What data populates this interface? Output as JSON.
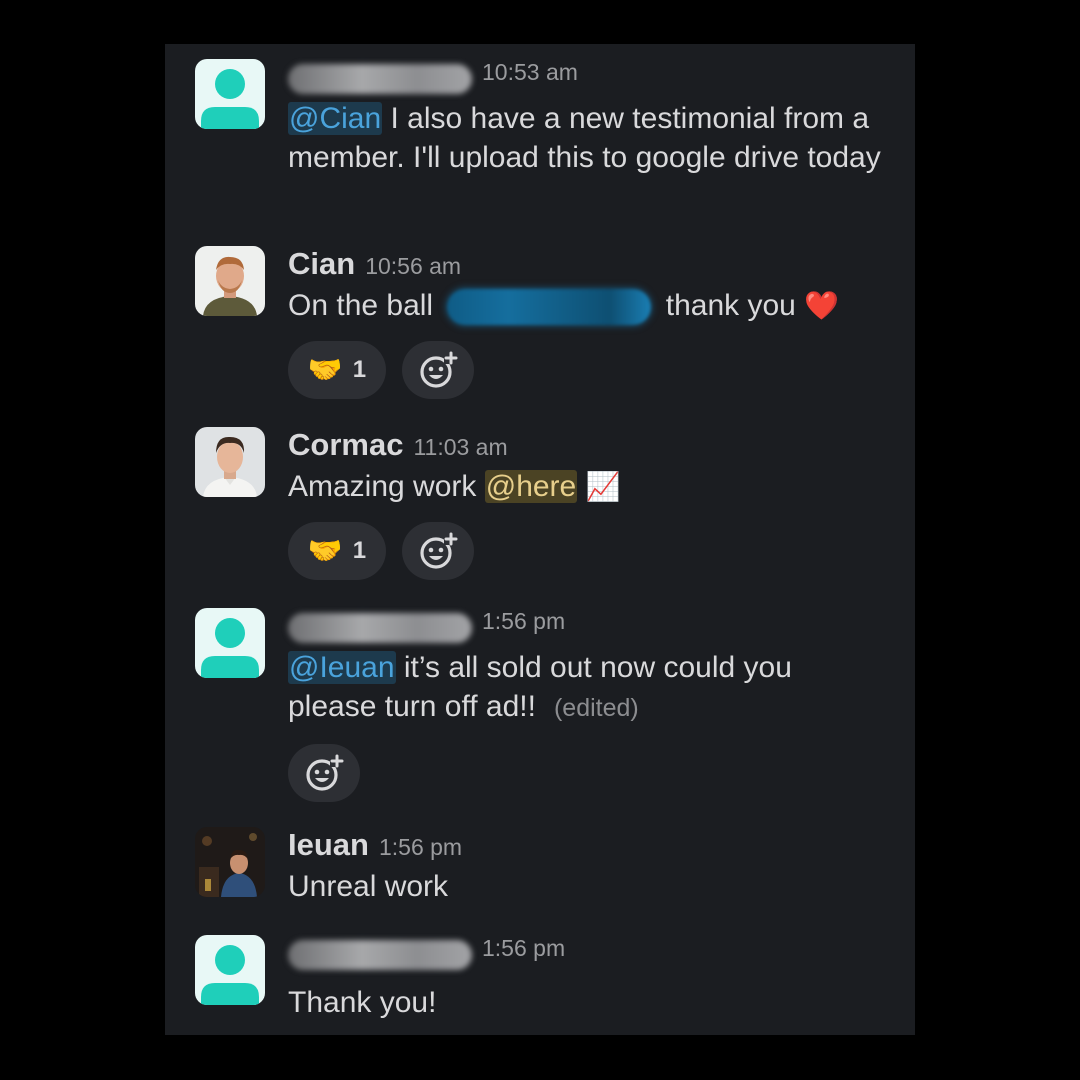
{
  "messages": [
    {
      "sender": "",
      "sender_blurred": true,
      "avatar": "default-avatar-icon",
      "time": "10:53 am",
      "mention": "@Cian",
      "text": " I also have a new testimonial from a member. I'll upload this to google drive today"
    },
    {
      "sender": "Cian",
      "avatar": "photo-cian",
      "time": "10:56 am",
      "text_before": "On the ball ",
      "text_after": " thank you ",
      "emoji": "❤️",
      "reaction": {
        "emoji": "🤝",
        "count": "1",
        "icon": "handshake-icon"
      },
      "add_reaction_icon": "add-reaction-icon"
    },
    {
      "sender": "Cormac",
      "avatar": "photo-cormac",
      "time": "11:03 am",
      "text": "Amazing work ",
      "here": "@here",
      "emoji": "📈",
      "reaction": {
        "emoji": "🤝",
        "count": "1",
        "icon": "handshake-icon"
      },
      "add_reaction_icon": "add-reaction-icon"
    },
    {
      "sender": "",
      "sender_blurred": true,
      "avatar": "default-avatar-icon",
      "time": "1:56 pm",
      "mention": "@Ieuan",
      "text": " it’s all sold out now could you please turn off ad!!",
      "edited": "(edited)",
      "add_reaction_icon": "add-reaction-icon"
    },
    {
      "sender": "Ieuan",
      "avatar": "photo-ieuan",
      "time": "1:56 pm",
      "text": "Unreal work"
    },
    {
      "sender": "",
      "sender_blurred": true,
      "avatar": "default-avatar-icon",
      "time": "1:56 pm",
      "text": "Thank you!"
    }
  ],
  "colors": {
    "background": "#000000",
    "panel": "#1b1d21",
    "text": "#d9d9db",
    "muted": "#9b9c9f",
    "mention_bg": "#1d3a4d",
    "mention_fg": "#4aa3dc",
    "here_bg": "#4b4324",
    "here_fg": "#e7cf8c",
    "default_avatar_bg": "#e8f8f6",
    "default_avatar_fg": "#1fcfba",
    "reaction_pill": "#2d2f34"
  }
}
